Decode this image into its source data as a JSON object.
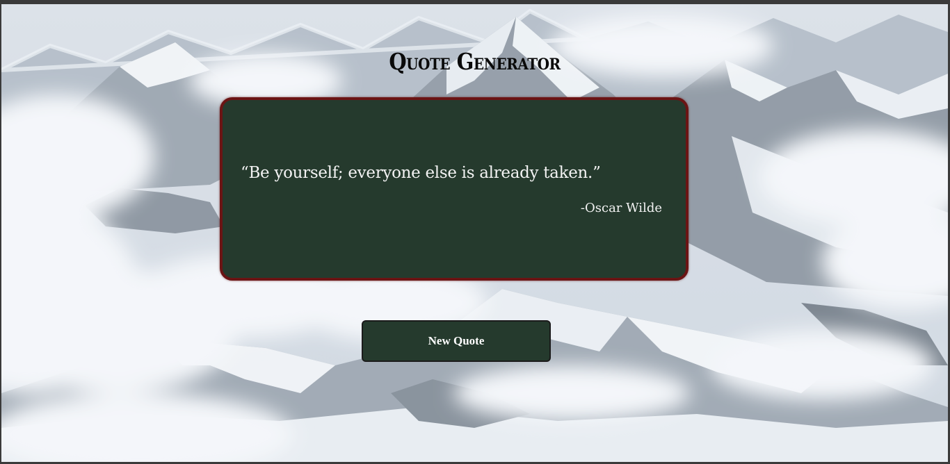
{
  "header": {
    "title": "Quote Generator"
  },
  "quote": {
    "text": "“Be yourself; everyone else is already taken.”",
    "author": "-Oscar Wilde"
  },
  "controls": {
    "new_quote_label": "New Quote"
  },
  "colors": {
    "card_background": "#253a2d",
    "card_border": "#6b1414",
    "button_background": "#253a2d",
    "text_light": "#f3f3f3",
    "title_text": "#0a0a0a"
  },
  "background": {
    "icon": "snowy-mountains-background"
  }
}
